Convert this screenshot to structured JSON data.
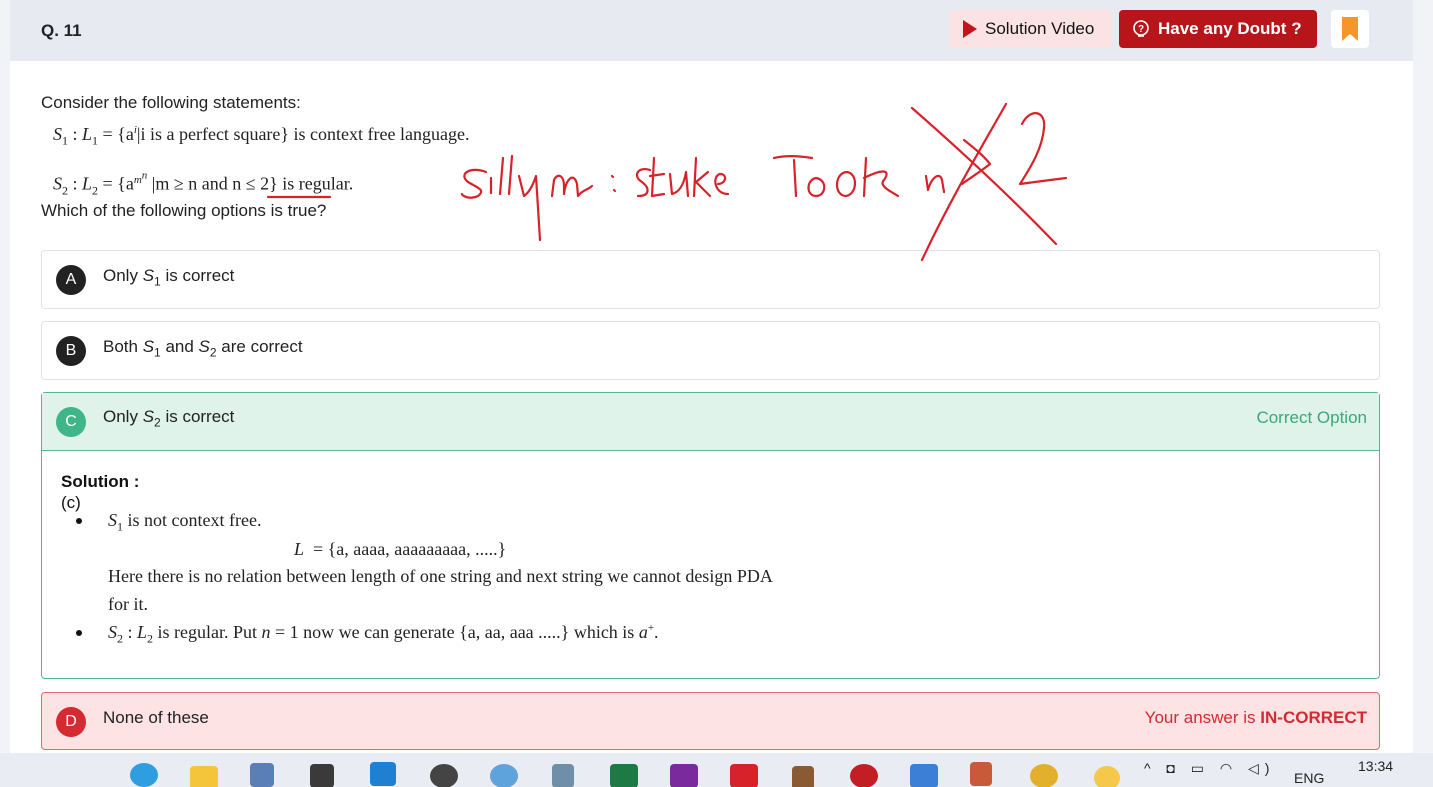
{
  "question": {
    "number": "Q. 11",
    "intro": "Consider the following statements:",
    "ask": "Which of the following options is true?"
  },
  "header": {
    "solution_video_label": "Solution Video",
    "doubt_label": "Have any Doubt ?"
  },
  "statements": {
    "s1": {
      "name": "S",
      "name_sub": "1",
      "lang": "L",
      "lang_sub": "1",
      "set_open": "= {a",
      "exp": "i",
      "cond": "i is a perfect square} is context free language."
    },
    "s2": {
      "name": "S",
      "name_sub": "2",
      "lang": "L",
      "lang_sub": "2",
      "set_open": "= {a",
      "exp": "m",
      "exp2": "n",
      "cond_a": "m ≥ n and",
      "cond_b": "n ≤ 2} is regular."
    }
  },
  "options": {
    "a": {
      "letter": "A",
      "text_pre": "Only ",
      "s": "S",
      "sub": "1",
      "text_post": " is correct"
    },
    "b": {
      "letter": "B",
      "text_pre": "Both ",
      "s1": "S",
      "sub1": "1",
      "mid": " and ",
      "s2": "S",
      "sub2": "2",
      "text_post": " are correct"
    },
    "c": {
      "letter": "C",
      "text_pre": "Only ",
      "s": "S",
      "sub": "2",
      "text_post": " is correct",
      "status": "Correct Option"
    },
    "d": {
      "letter": "D",
      "text": "None of these",
      "status_pre": "Your answer is ",
      "status_bold": "IN-CORRECT"
    }
  },
  "solution": {
    "title": "Solution :",
    "answer": "(c)",
    "line1_s": "S",
    "line1_sub": "1",
    "line1_text": " is not context free.",
    "line2_l": "L",
    "line2_text": "= {a, aaaa, aaaaaaaaa, .....}",
    "line3": "Here there is no relation between length of one string and next string we cannot design PDA",
    "line4": "for it.",
    "line5_s": "S",
    "line5_sub": "2",
    "line5_colon": " : ",
    "line5_l": "L",
    "line5_lsub": "2",
    "line5_text_a": " is regular. Put ",
    "line5_n": "n",
    "line5_text_b": " = 1 now we can generate {a, aa, aaa .....} which is ",
    "line5_a": "a",
    "line5_sup": "+",
    "line5_end": "."
  },
  "handwriting": {
    "text": "Silly mistake TOOK n≥2"
  },
  "taskbar": {
    "icons": [
      "edge-icon",
      "file-explorer-icon",
      "virtualbox-icon",
      "unity-icon",
      "vscode-icon",
      "clock-app-icon",
      "qbittorrent-icon",
      "calculator-icon",
      "excel-icon",
      "onenote-icon",
      "app-gear-icon",
      "minecraft-icon",
      "davinci-icon",
      "app-m-icon",
      "app-figure-icon",
      "chrome-icon",
      "weather-icon"
    ],
    "lang": "ENG",
    "time": "13:34"
  },
  "colors": {
    "accent_red": "#b8151b",
    "correct_green": "#3fb58a",
    "incorrect_red": "#d42a31",
    "ink_red": "#d8222a"
  }
}
